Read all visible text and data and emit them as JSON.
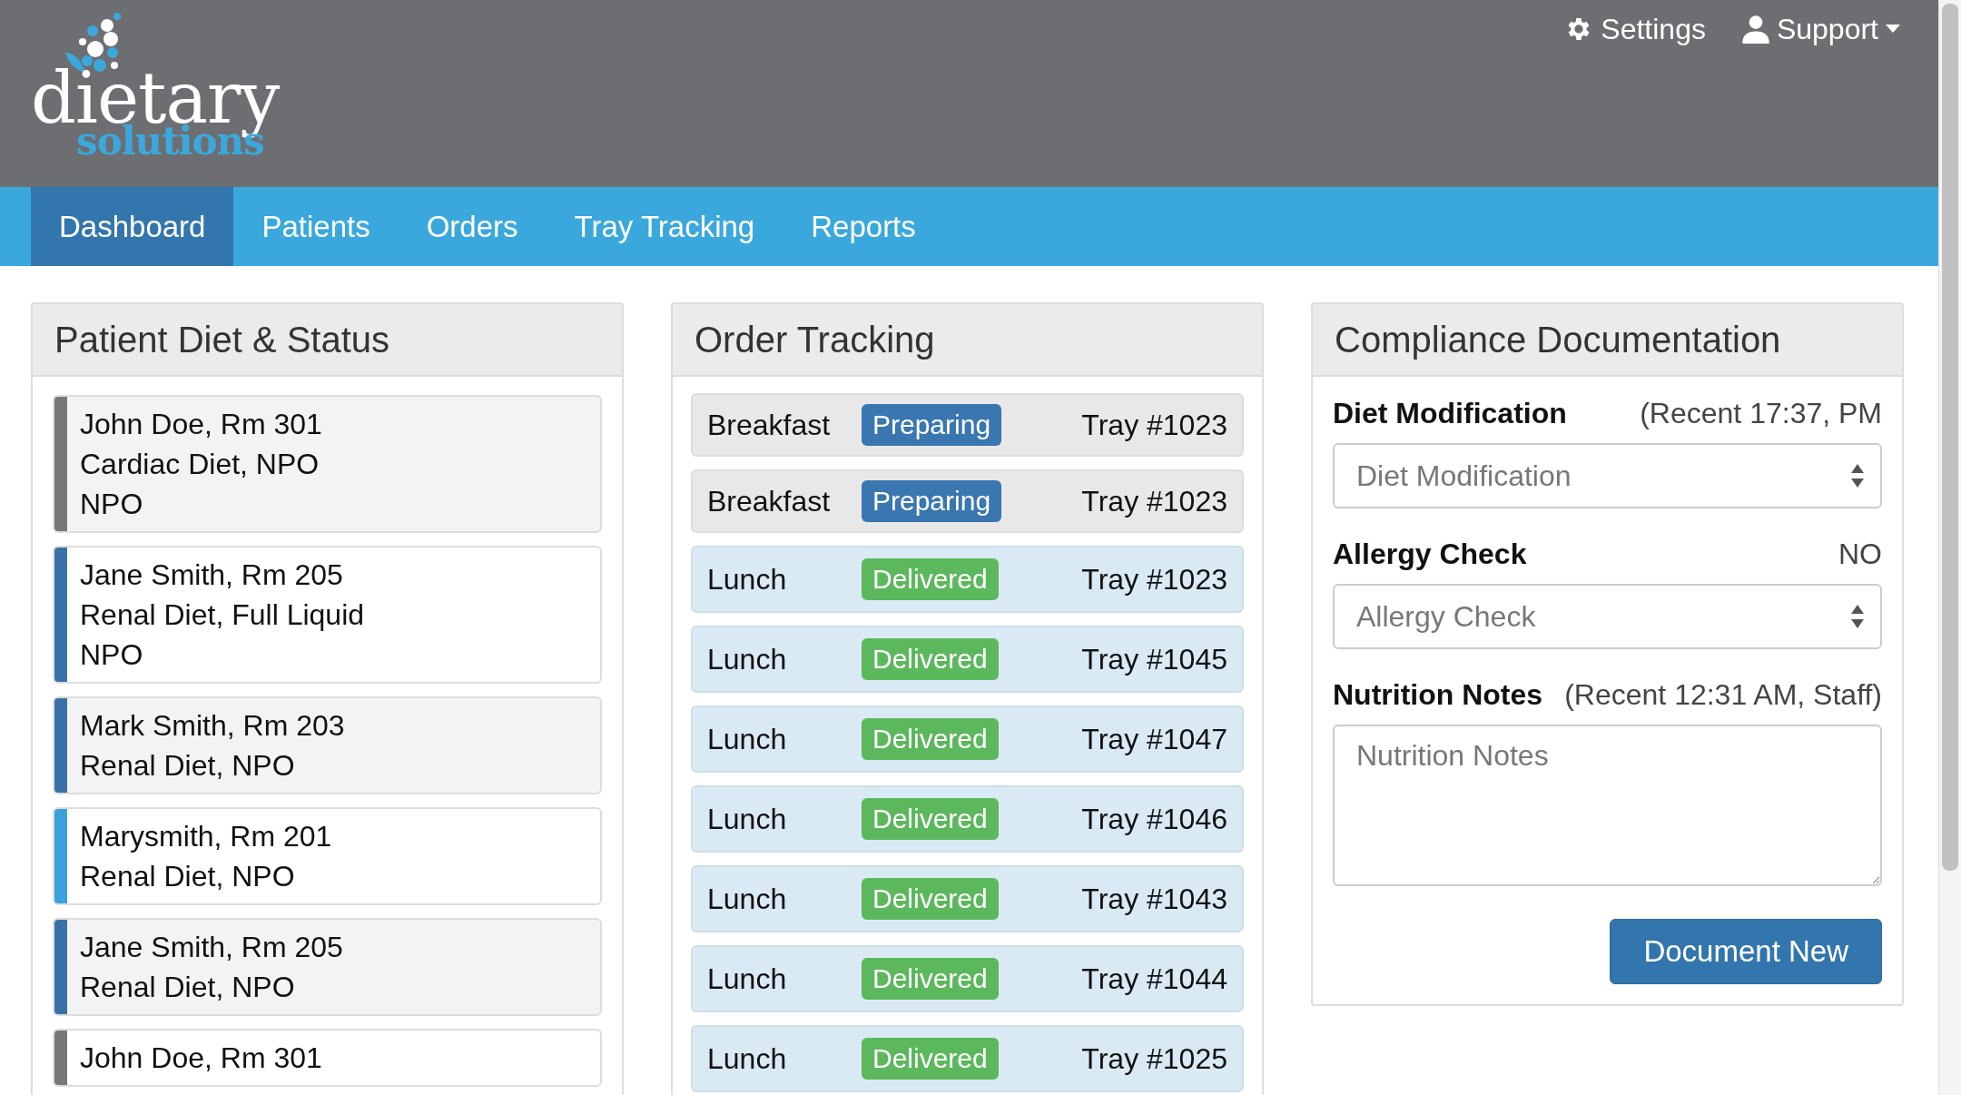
{
  "logo": {
    "word": "dietary",
    "subword": "solutions"
  },
  "header_links": [
    {
      "kind": "settings",
      "label": "Settings"
    },
    {
      "kind": "user",
      "label": "Support"
    }
  ],
  "nav": [
    {
      "label": "Dashboard",
      "selected": true
    },
    {
      "label": "Patients",
      "selected": false
    },
    {
      "label": "Orders",
      "selected": false
    },
    {
      "label": "Tray Tracking",
      "selected": false
    },
    {
      "label": "Reports",
      "selected": false
    }
  ],
  "patient_panel": {
    "title": "Patient Diet & Status",
    "patients": [
      {
        "lines": [
          "John Doe, Rm 301",
          "Cardiac Diet, NPO",
          "NPO"
        ],
        "color": "#777777"
      },
      {
        "lines": [
          "Jane Smith, Rm 205",
          "Renal Diet, Full Liquid",
          "NPO"
        ],
        "color": "#3a72a8"
      },
      {
        "lines": [
          "Mark Smith, Rm 203",
          "Renal Diet, NPO"
        ],
        "color": "#3a72a8"
      },
      {
        "lines": [
          "Marysmith, Rm 201",
          "Renal Diet, NPO"
        ],
        "color": "#3aa2da"
      },
      {
        "lines": [
          "Jane Smith, Rm 205",
          "Renal Diet, NPO"
        ],
        "color": "#3a72a8"
      },
      {
        "lines": [
          "John Doe, Rm 301"
        ],
        "color": "#777777"
      }
    ]
  },
  "order_panel": {
    "title": "Order Tracking",
    "orders": [
      {
        "meal": "Breakfast",
        "kind": "preparing",
        "status": "Preparing",
        "tray": "Tray #1023"
      },
      {
        "meal": "Breakfast",
        "kind": "preparing",
        "status": "Preparing",
        "tray": "Tray #1023"
      },
      {
        "meal": "Lunch",
        "kind": "delivered",
        "status": "Delivered",
        "tray": "Tray #1023"
      },
      {
        "meal": "Lunch",
        "kind": "delivered",
        "status": "Delivered",
        "tray": "Tray #1045"
      },
      {
        "meal": "Lunch",
        "kind": "delivered",
        "status": "Delivered",
        "tray": "Tray #1047"
      },
      {
        "meal": "Lunch",
        "kind": "delivered",
        "status": "Delivered",
        "tray": "Tray #1046"
      },
      {
        "meal": "Lunch",
        "kind": "delivered",
        "status": "Delivered",
        "tray": "Tray #1043"
      },
      {
        "meal": "Lunch",
        "kind": "delivered",
        "status": "Delivered",
        "tray": "Tray #1044"
      },
      {
        "meal": "Lunch",
        "kind": "delivered",
        "status": "Delivered",
        "tray": "Tray #1025"
      }
    ]
  },
  "compliance_panel": {
    "title": "Compliance Documentation",
    "fields": [
      {
        "kind": "select",
        "label": "Diet Modification",
        "note": "(Recent 17:37, PM",
        "placeholder": "Diet Modification"
      },
      {
        "kind": "select",
        "label": "Allergy Check",
        "note": "NO",
        "placeholder": "Allergy Check"
      },
      {
        "kind": "textarea",
        "label": "Nutrition Notes",
        "note": "(Recent 12:31 AM, Staff)",
        "placeholder": "Nutrition Notes"
      }
    ],
    "button": "Document New"
  }
}
